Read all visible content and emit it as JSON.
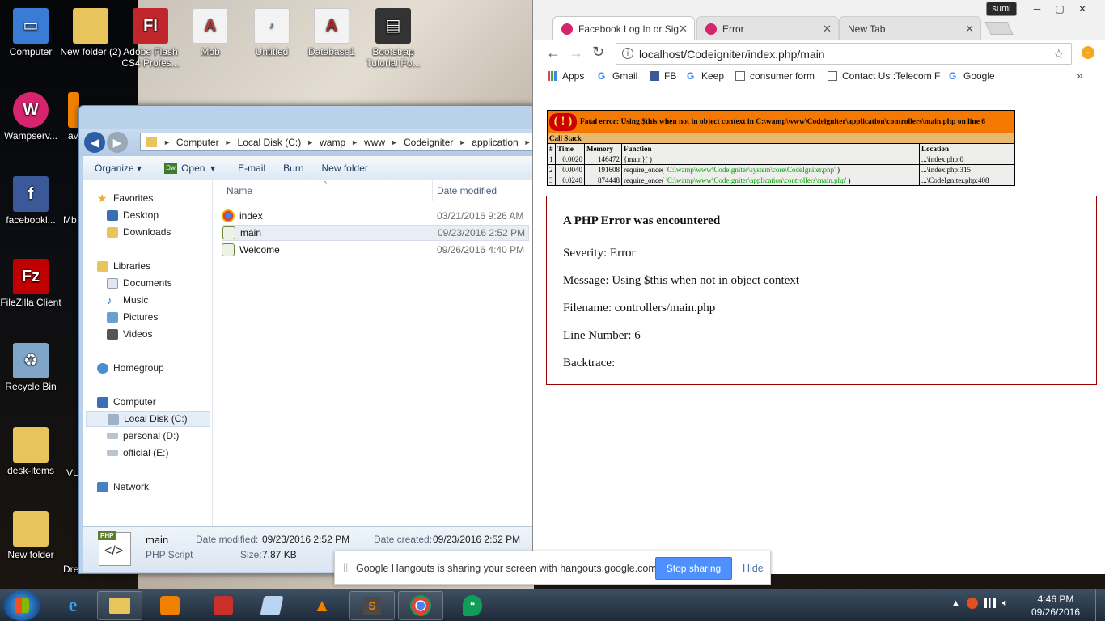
{
  "desktop": {
    "icons": [
      {
        "label": "Computer",
        "color": "#3a7bd5"
      },
      {
        "label": "New folder (2)",
        "color": "#e8c45c"
      },
      {
        "label": "Adobe Flash CS4 Profes...",
        "color": "#c0262c"
      },
      {
        "label": "Mob",
        "color": "#b63a3a"
      },
      {
        "label": "Untitled",
        "color": "#2c6fb0"
      },
      {
        "label": "Database1",
        "color": "#a82c2c"
      },
      {
        "label": "Bootstrap Tutorial Fo...",
        "color": "#333333"
      },
      {
        "label": "Wampserv...",
        "color": "#d6246e"
      },
      {
        "label": "facebookl...",
        "color": "#3b5998"
      },
      {
        "label": "FileZilla Client",
        "color": "#bf0000"
      },
      {
        "label": "Recycle Bin",
        "color": "#7fa6c9"
      },
      {
        "label": "desk-items",
        "color": "#e8c45c"
      },
      {
        "label": "New folder",
        "color": "#e8c45c"
      }
    ],
    "partial_labels": {
      "av": "av",
      "mb": "Mb",
      "vl": "VL",
      "dre": "Dre"
    }
  },
  "explorer": {
    "path": [
      "Computer",
      "Local Disk (C:)",
      "wamp",
      "www",
      "Codeigniter",
      "application"
    ],
    "toolbar": {
      "organize": "Organize",
      "open": "Open",
      "email": "E-mail",
      "burn": "Burn",
      "new_folder": "New folder"
    },
    "nav": {
      "favorites": "Favorites",
      "desktop": "Desktop",
      "downloads": "Downloads",
      "libraries": "Libraries",
      "documents": "Documents",
      "music": "Music",
      "pictures": "Pictures",
      "videos": "Videos",
      "homegroup": "Homegroup",
      "computer": "Computer",
      "local_disk": "Local Disk (C:)",
      "personal": "personal (D:)",
      "official": "official (E:)",
      "network": "Network"
    },
    "columns": {
      "name": "Name",
      "date": "Date modified"
    },
    "files": [
      {
        "name": "index",
        "date": "03/21/2016 9:26 AM"
      },
      {
        "name": "main",
        "date": "09/23/2016 2:52 PM"
      },
      {
        "name": "Welcome",
        "date": "09/26/2016 4:40 PM"
      }
    ],
    "details": {
      "badge": "PHP",
      "name": "main",
      "type": "PHP Script",
      "modified_label": "Date modified:",
      "modified": "09/23/2016 2:52 PM",
      "created_label": "Date created:",
      "created": "09/23/2016 2:52 PM",
      "size_label": "Size:",
      "size": "7.87 KB"
    }
  },
  "chrome": {
    "user": "sumi",
    "tabs": [
      {
        "title": "Facebook Log In or Sig"
      },
      {
        "title": "Error"
      },
      {
        "title": "New Tab"
      }
    ],
    "url": "localhost/Codeigniter/index.php/main",
    "bookmarks": [
      "Apps",
      "Gmail",
      "FB",
      "Keep",
      "consumer form",
      "Contact Us :Telecom F",
      "Google"
    ],
    "xdebug": {
      "fatal": "Fatal error: Using $this when not in object context in C:\\wamp\\www\\Codeigniter\\application\\controllers\\main.php on line 6",
      "call_stack": "Call Stack",
      "headers": [
        "#",
        "Time",
        "Memory",
        "Function",
        "Location"
      ],
      "rows": [
        {
          "n": "1",
          "time": "0.0020",
          "mem": "146472",
          "func": "{main}( )",
          "arg": "",
          "loc": "...\\index.php:0"
        },
        {
          "n": "2",
          "time": "0.0040",
          "mem": "191608",
          "func": "require_once( ",
          "arg": "'C:\\wamp\\www\\Codeigniter\\system\\core\\CodeIgniter.php'",
          "loc": "...\\index.php:315"
        },
        {
          "n": "3",
          "time": "0.0240",
          "mem": "874448",
          "func": "require_once( ",
          "arg": "'C:\\wamp\\www\\Codeigniter\\application\\controllers\\main.php'",
          "loc": "...\\CodeIgniter.php:408"
        }
      ]
    },
    "ci_error": {
      "heading": "A PHP Error was encountered",
      "severity": "Severity: Error",
      "message": "Message: Using $this when not in object context",
      "filename": "Filename: controllers/main.php",
      "line": "Line Number: 6",
      "backtrace": "Backtrace:"
    }
  },
  "hangouts": {
    "message": "Google Hangouts is sharing your screen with hangouts.google.com.",
    "stop": "Stop sharing",
    "hide": "Hide"
  },
  "taskbar": {
    "time": "4:46 PM",
    "date": "09/26/2016"
  }
}
